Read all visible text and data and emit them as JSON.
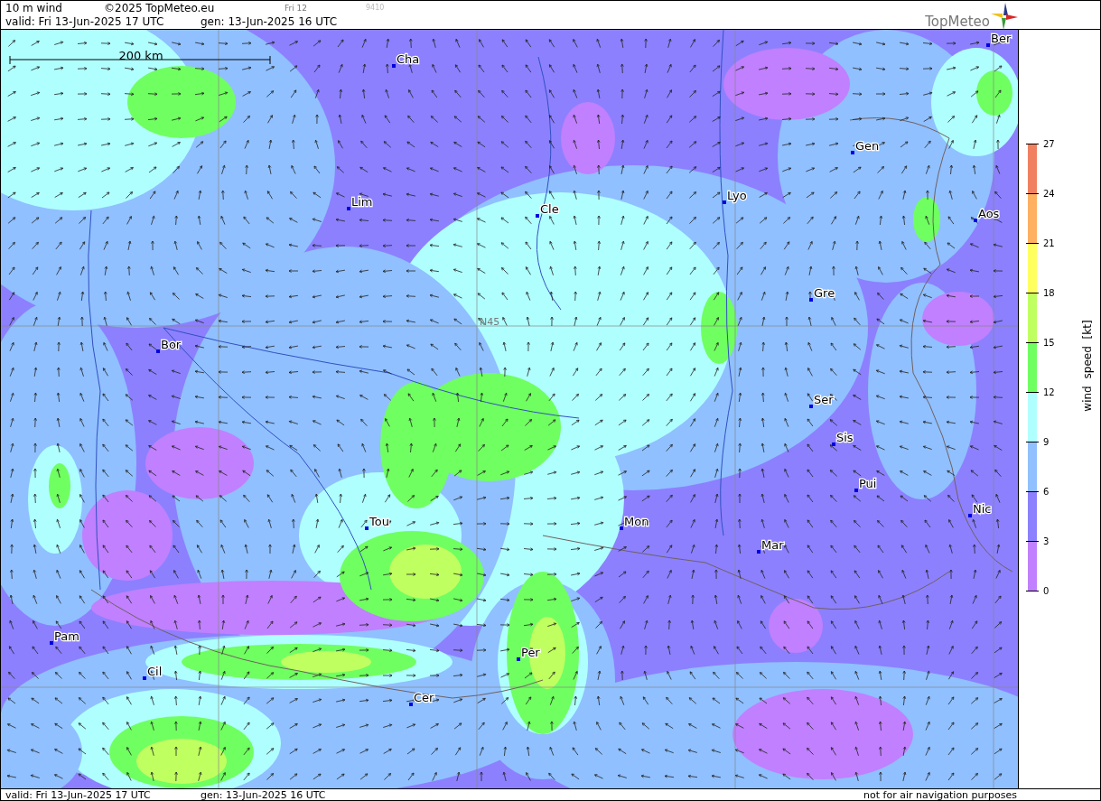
{
  "header": {
    "product": "10 m wind",
    "copyright": "©2025 TopMeteo.eu",
    "run_day": "Fri 12",
    "code": "9410",
    "valid": "valid:  Fri  13-Jun-2025  17 UTC",
    "generated": "gen: 13-Jun-2025 16 UTC",
    "logo": "TopMeteo"
  },
  "map": {
    "scale_label": "200 km",
    "latitude_label": "N45",
    "cities": [
      {
        "name": "Cha"
      },
      {
        "name": "Ber"
      },
      {
        "name": "Gen"
      },
      {
        "name": "Lim"
      },
      {
        "name": "Cle"
      },
      {
        "name": "Lyo"
      },
      {
        "name": "Aos"
      },
      {
        "name": "Gre"
      },
      {
        "name": "Bor"
      },
      {
        "name": "Ser"
      },
      {
        "name": "Sis"
      },
      {
        "name": "Pui"
      },
      {
        "name": "Nic"
      },
      {
        "name": "Tou"
      },
      {
        "name": "Mon"
      },
      {
        "name": "Mar"
      },
      {
        "name": "Pam"
      },
      {
        "name": "Cil"
      },
      {
        "name": "Per"
      },
      {
        "name": "Cer"
      }
    ]
  },
  "legend": {
    "title": "wind speed [kt]",
    "ticks": [
      "27",
      "24",
      "21",
      "18",
      "15",
      "12",
      "9",
      "6",
      "3",
      "0"
    ],
    "bands": [
      {
        "color": "#f08060"
      },
      {
        "color": "#ffb060"
      },
      {
        "color": "#ffff60"
      },
      {
        "color": "#c0ff60"
      },
      {
        "color": "#70ff60"
      },
      {
        "color": "#b0ffff"
      },
      {
        "color": "#90c0ff"
      },
      {
        "color": "#8c80ff"
      },
      {
        "color": "#c080ff"
      }
    ]
  },
  "footer": {
    "valid": "valid:  Fri  13-Jun-2025  17 UTC",
    "generated": "gen: 13-Jun-2025 16 UTC",
    "disclaimer": "not for air navigation purposes"
  }
}
